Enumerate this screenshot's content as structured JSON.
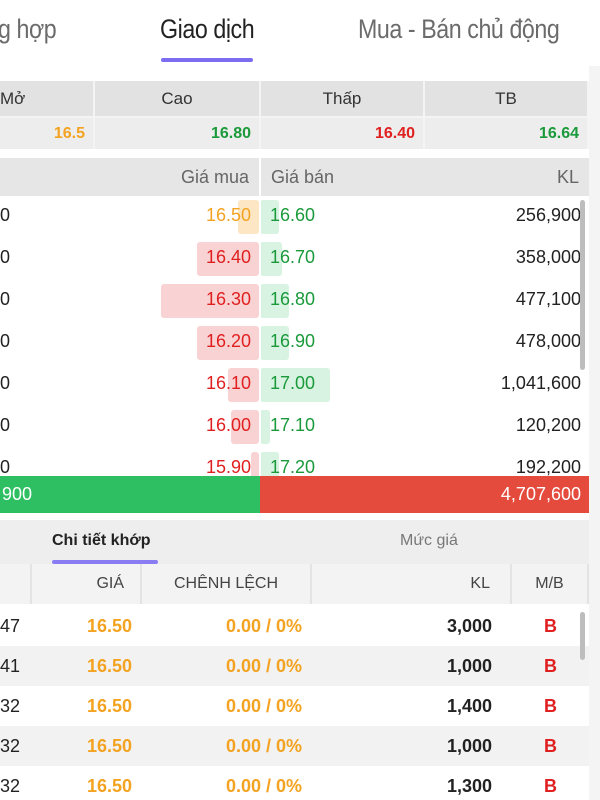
{
  "tabs": [
    {
      "label": "g hợp",
      "active": false
    },
    {
      "label": "Giao dịch",
      "active": true
    },
    {
      "label": "Mua - Bán chủ động",
      "active": false
    }
  ],
  "summary": {
    "headers": [
      "Mở",
      "Cao",
      "Thấp",
      "TB"
    ],
    "values": [
      "16.5",
      "16.80",
      "16.40",
      "16.64"
    ],
    "colors": [
      "#f3a321",
      "#1a9a3a",
      "#e02020",
      "#1a9a3a"
    ]
  },
  "orderbook": {
    "buy_header": "Giá mua",
    "sell_header": "Giá bán",
    "vol_header": "KL",
    "rows": [
      {
        "left": "0",
        "buy": "16.50",
        "buy_color": "#f3a321",
        "buy_bar_color": "#fde6c4",
        "buy_depth": 0.08,
        "sell": "16.60",
        "sell_depth": 0.06,
        "vol": "256,900"
      },
      {
        "left": "0",
        "buy": "16.40",
        "buy_color": "#e02020",
        "buy_bar_color": "#f9d3d3",
        "buy_depth": 0.24,
        "sell": "16.70",
        "sell_depth": 0.07,
        "vol": "358,000"
      },
      {
        "left": "0",
        "buy": "16.30",
        "buy_color": "#e02020",
        "buy_bar_color": "#f9d3d3",
        "buy_depth": 0.38,
        "sell": "16.80",
        "sell_depth": 0.09,
        "vol": "477,100"
      },
      {
        "left": "0",
        "buy": "16.20",
        "buy_color": "#e02020",
        "buy_bar_color": "#f9d3d3",
        "buy_depth": 0.24,
        "sell": "16.90",
        "sell_depth": 0.09,
        "vol": "478,000"
      },
      {
        "left": "0",
        "buy": "16.10",
        "buy_color": "#e02020",
        "buy_bar_color": "#f9d3d3",
        "buy_depth": 0.12,
        "sell": "17.00",
        "sell_depth": 0.22,
        "vol": "1,041,600"
      },
      {
        "left": "0",
        "buy": "16.00",
        "buy_color": "#e02020",
        "buy_bar_color": "#f9d3d3",
        "buy_depth": 0.11,
        "sell": "17.10",
        "sell_depth": 0.03,
        "vol": "120,200"
      },
      {
        "left": "0",
        "buy": "15.90",
        "buy_color": "#e02020",
        "buy_bar_color": "#f9d3d3",
        "buy_depth": 0.03,
        "sell": "17.20",
        "sell_depth": 0.06,
        "vol": "192,200"
      }
    ],
    "total_buy": "900",
    "total_sell": "4,707,600"
  },
  "bottom_tabs": [
    {
      "label": "Chi tiết khớp",
      "active": true
    },
    {
      "label": "Mức giá",
      "active": false
    }
  ],
  "match": {
    "headers": [
      "",
      "GIÁ",
      "CHÊNH LỆCH",
      "KL",
      "M/B"
    ],
    "rows": [
      {
        "time": "47",
        "price": "16.50",
        "change": "0.00 / 0%",
        "vol": "3,000",
        "side": "B"
      },
      {
        "time": "41",
        "price": "16.50",
        "change": "0.00 / 0%",
        "vol": "1,000",
        "side": "B"
      },
      {
        "time": "32",
        "price": "16.50",
        "change": "0.00 / 0%",
        "vol": "1,400",
        "side": "B"
      },
      {
        "time": "32",
        "price": "16.50",
        "change": "0.00 / 0%",
        "vol": "1,000",
        "side": "B"
      },
      {
        "time": "32",
        "price": "16.50",
        "change": "0.00 / 0%",
        "vol": "1,300",
        "side": "B"
      }
    ]
  }
}
